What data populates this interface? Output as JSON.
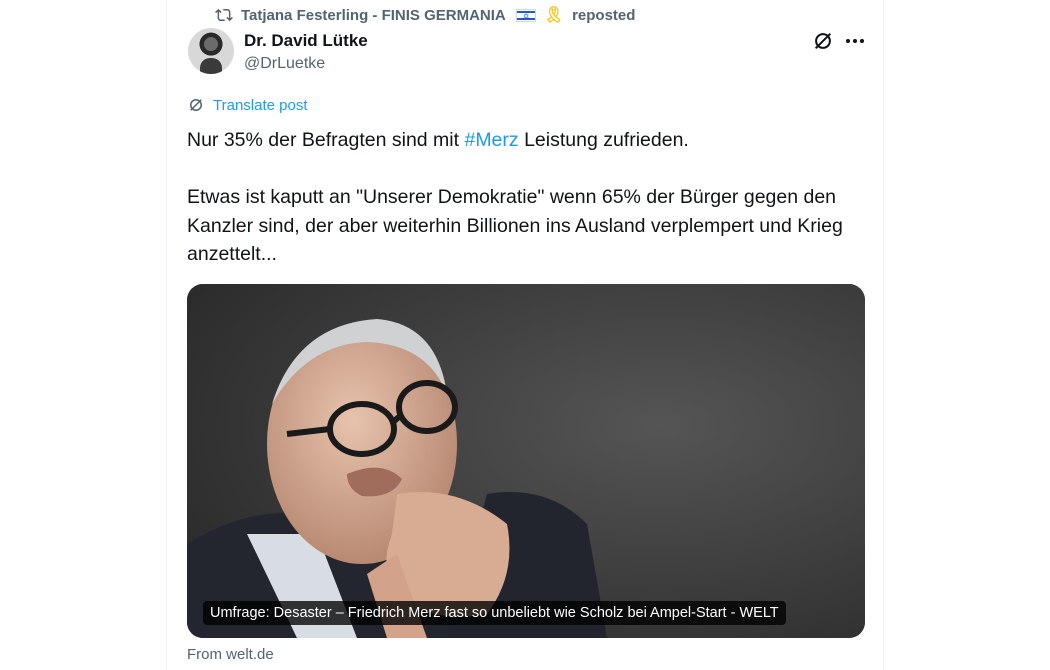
{
  "repost": {
    "user": "Tatjana Festerling - FINIS GERMANIA",
    "flag_icon": "israel-flag-icon",
    "ribbon_icon": "yellow-ribbon-icon",
    "action": "reposted"
  },
  "author": {
    "display_name": "Dr. David Lütke",
    "handle": "@DrLuetke"
  },
  "translate_label": "Translate post",
  "tweet": {
    "line1_before": "Nur 35% der Befragten sind mit ",
    "hashtag": "#Merz",
    "line1_after": " Leistung zufrieden.",
    "paragraph2": "Etwas ist kaputt an \"Unserer Demokratie\" wenn 65% der Bürger gegen den Kanzler sind, der aber weiterhin Billionen ins Ausland verplempert und Krieg anzettelt..."
  },
  "card": {
    "caption": "Umfrage: Desaster – Friedrich Merz fast so unbeliebt wie Scholz bei Ampel-Start - WELT",
    "source": "From welt.de"
  },
  "colors": {
    "accent": "#1d9bf0",
    "secondary_text": "#536471",
    "primary_text": "#0f1419"
  }
}
